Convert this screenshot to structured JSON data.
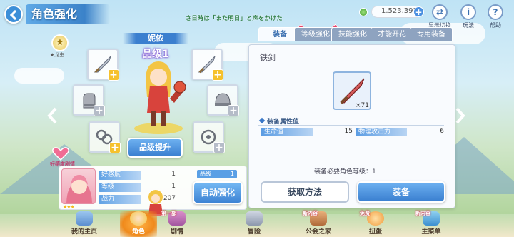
{
  "header": {
    "title": "角色强化",
    "notice": "さ日時は「また明日」と声をかけた",
    "currency": "1.523.393",
    "buttons": [
      {
        "label": "显示切换",
        "icon": "swap-icon"
      },
      {
        "label": "玩法",
        "icon": "info-icon"
      },
      {
        "label": "帮助",
        "icon": "help-icon"
      }
    ]
  },
  "character": {
    "name": "妮侬",
    "rank": "品级1",
    "star_label": "★龙虫",
    "rank_up_label": "品级提升",
    "favor_label": "好感度剧情"
  },
  "tabs": [
    {
      "label": "装备",
      "active": true
    },
    {
      "label": "等级强化",
      "active": false
    },
    {
      "label": "技能强化",
      "active": false
    },
    {
      "label": "才能开花",
      "active": false
    },
    {
      "label": "专用装备",
      "active": false
    }
  ],
  "equipment_slots": [
    {
      "name": "sword",
      "icon": "sword-icon",
      "addable": true
    },
    {
      "name": "sword",
      "icon": "sword-icon",
      "addable": true
    },
    {
      "name": "glove",
      "icon": "glove-icon",
      "addable": false
    },
    {
      "name": "helmet",
      "icon": "helmet-icon",
      "addable": false
    },
    {
      "name": "accessory",
      "icon": "accessory-icon",
      "addable": true
    },
    {
      "name": "accessory",
      "icon": "accessory-icon",
      "addable": false
    }
  ],
  "detail": {
    "item_name": "铁剑",
    "item_count": "×71",
    "attr_header": "装备属性值",
    "attrs": [
      {
        "label": "生命值",
        "value": "15"
      },
      {
        "label": "物理攻击力",
        "value": "6"
      }
    ],
    "need_text": "装备必要角色等级：1",
    "get_button": "获取方法",
    "equip_button": "装备"
  },
  "stats": {
    "rows": [
      {
        "label": "好感度",
        "value": "1"
      },
      {
        "label": "等级",
        "value": "1"
      },
      {
        "label": "战力",
        "value": "207"
      }
    ],
    "rank_label": "品级",
    "rank_value": "1",
    "auto_button": "自动强化"
  },
  "nav": [
    {
      "label": "我的主页",
      "active": false,
      "new": ""
    },
    {
      "label": "角色",
      "active": true,
      "new": ""
    },
    {
      "label": "剧情",
      "active": false,
      "new": "第一部"
    },
    {
      "label": "冒险",
      "active": false,
      "new": ""
    },
    {
      "label": "公会之家",
      "active": false,
      "new": "新内容"
    },
    {
      "label": "扭蛋",
      "active": false,
      "new": "免费"
    },
    {
      "label": "主菜单",
      "active": false,
      "new": "新内容"
    }
  ],
  "colors": {
    "accent": "#3b7fcf",
    "plus": "#f5c12d",
    "active_nav": "#f08a1c"
  }
}
